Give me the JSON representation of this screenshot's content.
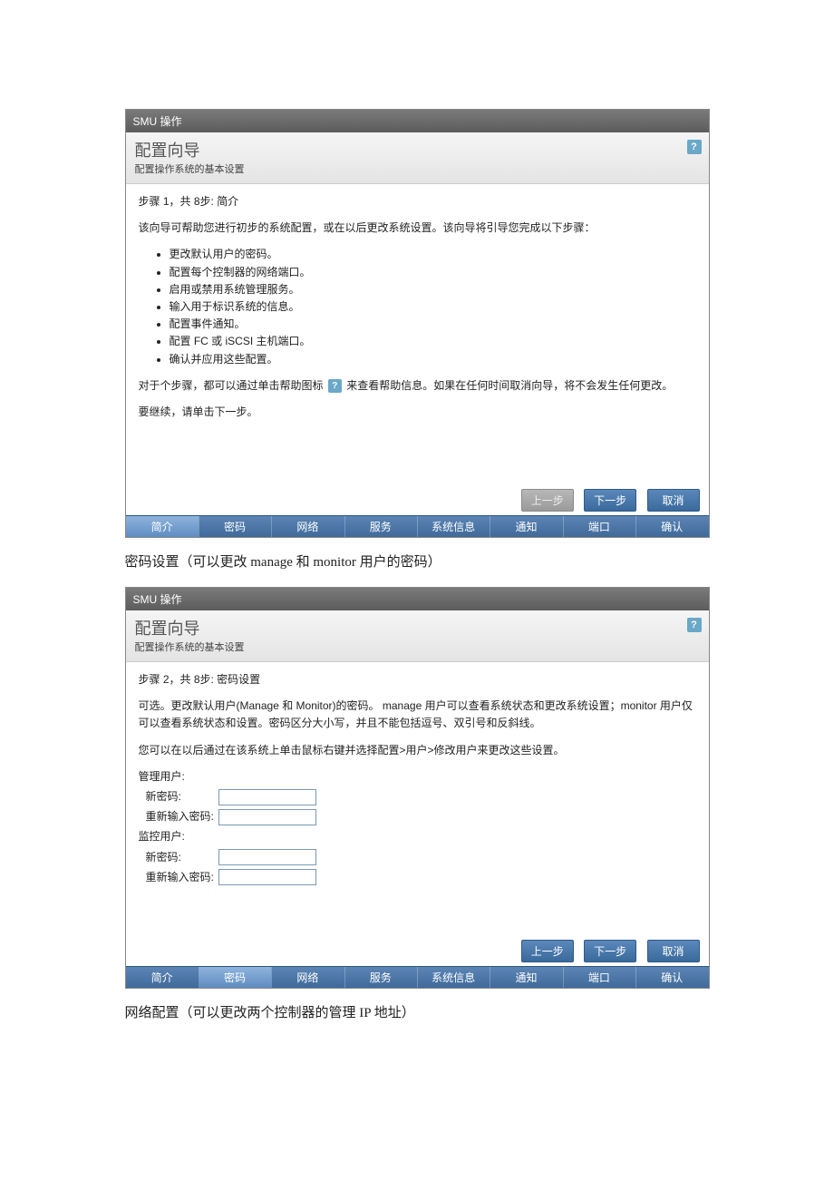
{
  "panel1": {
    "titlebar": "SMU 操作",
    "title": "配置向导",
    "subtitle": "配置操作系统的基本设置",
    "step_line": "步骤 1，共 8步: 简介",
    "intro": "该向导可帮助您进行初步的系统配置，或在以后更改系统设置。该向导将引导您完成以下步骤：",
    "bullets": [
      "更改默认用户的密码。",
      "配置每个控制器的网络端口。",
      "启用或禁用系统管理服务。",
      "输入用于标识系统的信息。",
      "配置事件通知。",
      "配置 FC 或 iSCSI 主机端口。",
      "确认并应用这些配置。"
    ],
    "help_para_a": "对于个步骤，都可以通过单击帮助图标",
    "help_para_b": "来查看帮助信息。如果在任何时间取消向导，将不会发生任何更改。",
    "continue": "要继续，请单击下一步。",
    "btn_prev": "上一步",
    "btn_next": "下一步",
    "btn_cancel": "取消",
    "steps": [
      "简介",
      "密码",
      "网络",
      "服务",
      "系统信息",
      "通知",
      "端口",
      "确认"
    ]
  },
  "caption1": "密码设置（可以更改 manage 和 monitor 用户的密码）",
  "panel2": {
    "titlebar": "SMU 操作",
    "title": "配置向导",
    "subtitle": "配置操作系统的基本设置",
    "step_line": "步骤 2，共 8步: 密码设置",
    "desc1": "可选。更改默认用户(Manage 和 Monitor)的密码。 manage 用户可以查看系统状态和更改系统设置；monitor 用户仅可以查看系统状态和设置。密码区分大小写，并且不能包括逗号、双引号和反斜线。",
    "desc2": "您可以在以后通过在该系统上单击鼠标右键并选择配置>用户>修改用户来更改这些设置。",
    "mgmt_user": "管理用户:",
    "new_pw": "新密码:",
    "re_pw": "重新输入密码:",
    "mon_user": "监控用户:",
    "btn_prev": "上一步",
    "btn_next": "下一步",
    "btn_cancel": "取消",
    "steps": [
      "简介",
      "密码",
      "网络",
      "服务",
      "系统信息",
      "通知",
      "端口",
      "确认"
    ]
  },
  "caption2": "网络配置（可以更改两个控制器的管理 IP 地址）"
}
